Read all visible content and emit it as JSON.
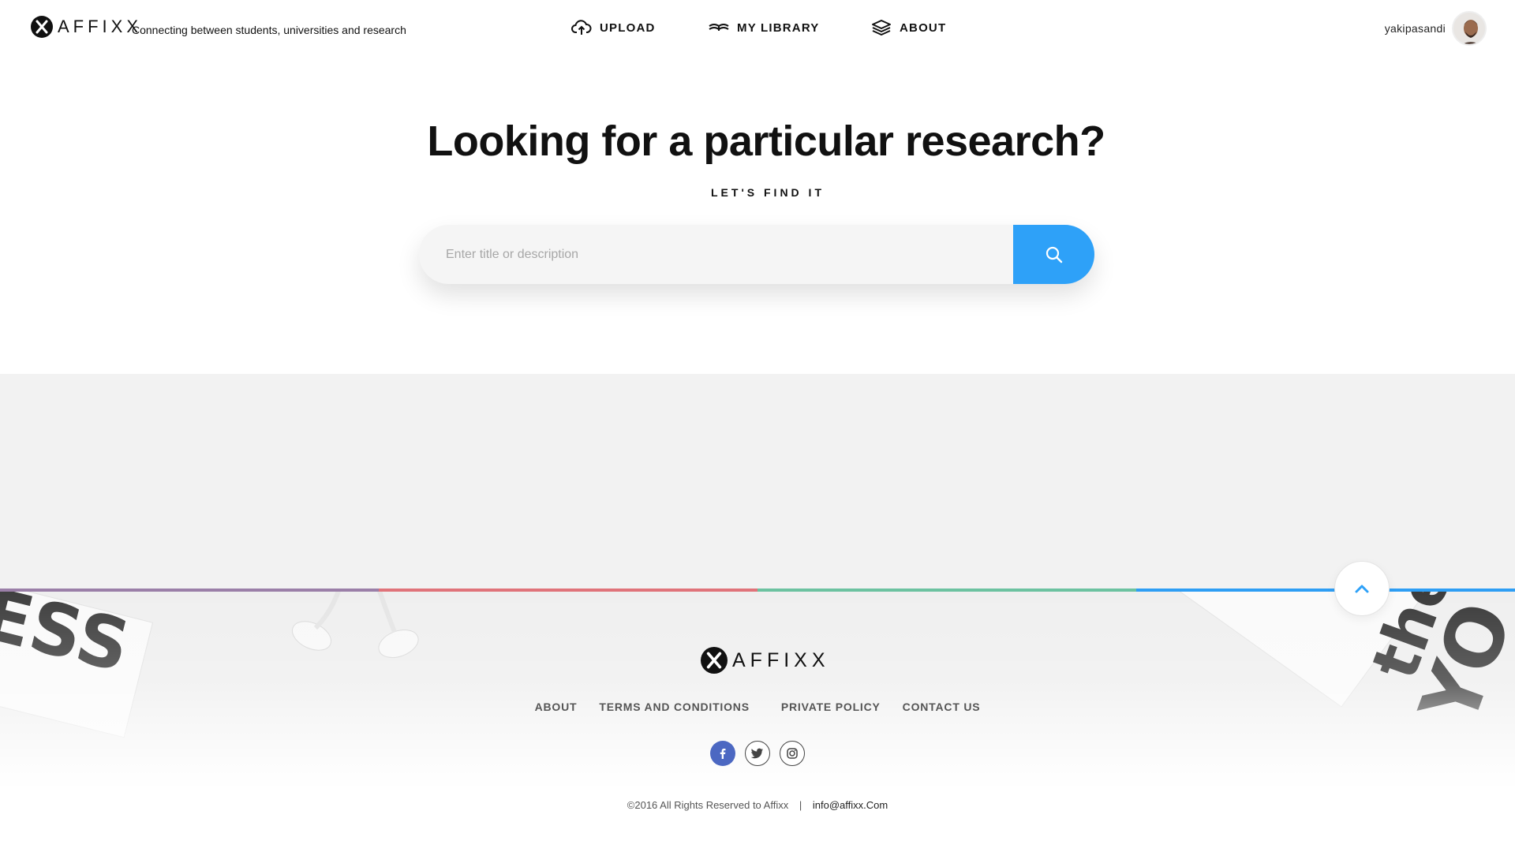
{
  "header": {
    "brand": "AFFIXX",
    "tagline": "Connecting between students, universities and research",
    "nav": [
      {
        "label": "UPLOAD",
        "icon": "cloud-upload-icon"
      },
      {
        "label": "MY LIBRARY",
        "icon": "book-icon"
      },
      {
        "label": "ABOUT",
        "icon": "layers-icon"
      }
    ],
    "user": {
      "name": "yakipasandi",
      "avatar": "avatar-photo"
    }
  },
  "hero": {
    "title": "Looking for a particular research?",
    "subtitle": "LET'S FIND IT",
    "search_placeholder": "Enter title or description",
    "search_icon": "search-icon"
  },
  "footer": {
    "brand": "AFFIXX",
    "links": [
      "ABOUT",
      "TERMS AND CONDITIONS",
      "PRIVATE POLICY",
      "CONTACT US"
    ],
    "social": [
      "facebook-icon",
      "twitter-icon",
      "instagram-icon"
    ],
    "copyright": "©2016 All Rights Reserved to Affixx",
    "separator": "|",
    "email": "info@affixx.Com",
    "bar_colors": [
      "#9b7fa8",
      "#e0737a",
      "#6cc2a0",
      "#2e9ef4"
    ],
    "accent": "#2ea1f8"
  }
}
